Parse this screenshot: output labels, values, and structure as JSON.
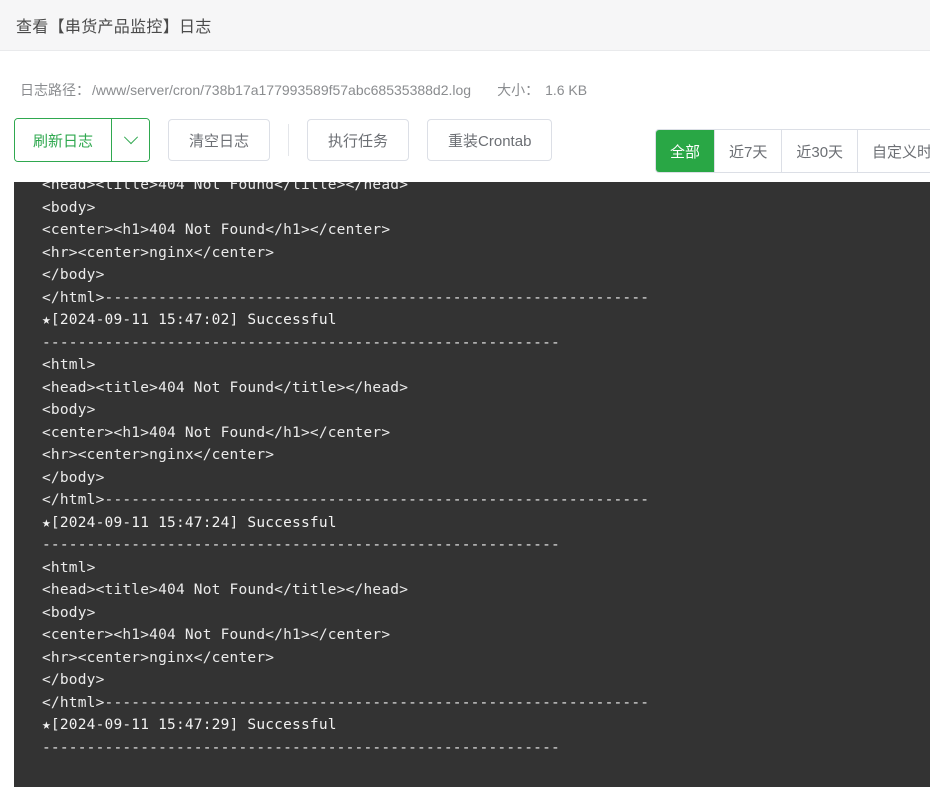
{
  "header": {
    "title": "查看【串货产品监控】日志"
  },
  "info": {
    "path_label": "日志路径：",
    "path_value": "/www/server/cron/738b17a177993589f57abc68535388d2.log",
    "size_label": "大小：",
    "size_value": "1.6 KB"
  },
  "toolbar": {
    "refresh_label": "刷新日志",
    "refresh_caret_icon": "chevron-down-icon",
    "clear_label": "清空日志",
    "run_label": "执行任务",
    "reload_crontab_label": "重装Crontab"
  },
  "range_filter": {
    "items": [
      {
        "label": "全部",
        "active": true
      },
      {
        "label": "近7天",
        "active": false
      },
      {
        "label": "近30天",
        "active": false
      },
      {
        "label": "自定义时间",
        "active": false
      }
    ]
  },
  "log": {
    "background_color": "#333333",
    "text_color": "#ebebeb",
    "lines": [
      "<head><title>404 Not Found</title></head>",
      "<body>",
      "<center><h1>404 Not Found</h1></center>",
      "<hr><center>nginx</center>",
      "</body>",
      "</html>-------------------------------------------------------------",
      "★[2024-09-11 15:47:02] Successful",
      "----------------------------------------------------------",
      "<html>",
      "<head><title>404 Not Found</title></head>",
      "<body>",
      "<center><h1>404 Not Found</h1></center>",
      "<hr><center>nginx</center>",
      "</body>",
      "</html>-------------------------------------------------------------",
      "★[2024-09-11 15:47:24] Successful",
      "----------------------------------------------------------",
      "<html>",
      "<head><title>404 Not Found</title></head>",
      "<body>",
      "<center><h1>404 Not Found</h1></center>",
      "<hr><center>nginx</center>",
      "</body>",
      "</html>-------------------------------------------------------------",
      "★[2024-09-11 15:47:29] Successful",
      "----------------------------------------------------------"
    ]
  },
  "colors": {
    "accent_green": "#29a745",
    "panel_dark": "#333333",
    "header_bg": "#f6f6f7",
    "muted_text": "#8a8c8f"
  }
}
